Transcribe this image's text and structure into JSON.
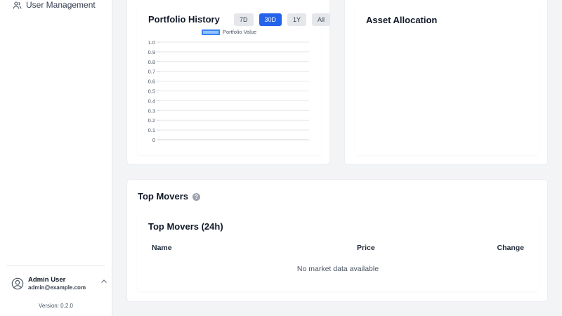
{
  "sidebar": {
    "nav_items": [
      {
        "label": "User Management",
        "icon": "users-icon"
      }
    ],
    "user": {
      "name": "Admin User",
      "email": "admin@example.com"
    },
    "version": "Version: 0.2.0"
  },
  "portfolio_history": {
    "title": "Portfolio History",
    "ranges": [
      "7D",
      "30D",
      "1Y",
      "All"
    ],
    "active_range": "30D",
    "legend_label": "Portfolio Value"
  },
  "asset_allocation": {
    "title": "Asset Allocation"
  },
  "top_movers": {
    "section_title": "Top Movers",
    "table_title": "Top Movers (24h)",
    "columns": [
      "Name",
      "Price",
      "Change"
    ],
    "empty_text": "No market data available"
  },
  "colors": {
    "primary": "#2563eb",
    "series_fill": "#93c5fd",
    "series_stroke": "#3b82f6"
  },
  "chart_data": {
    "type": "line",
    "series": [
      {
        "name": "Portfolio Value",
        "values": []
      }
    ],
    "categories": [],
    "yticks": [
      "1.0",
      "0.9",
      "0.8",
      "0.7",
      "0.6",
      "0.5",
      "0.4",
      "0.3",
      "0.2",
      "0.1",
      "0"
    ],
    "ylim": [
      0,
      1
    ],
    "grid": true
  }
}
